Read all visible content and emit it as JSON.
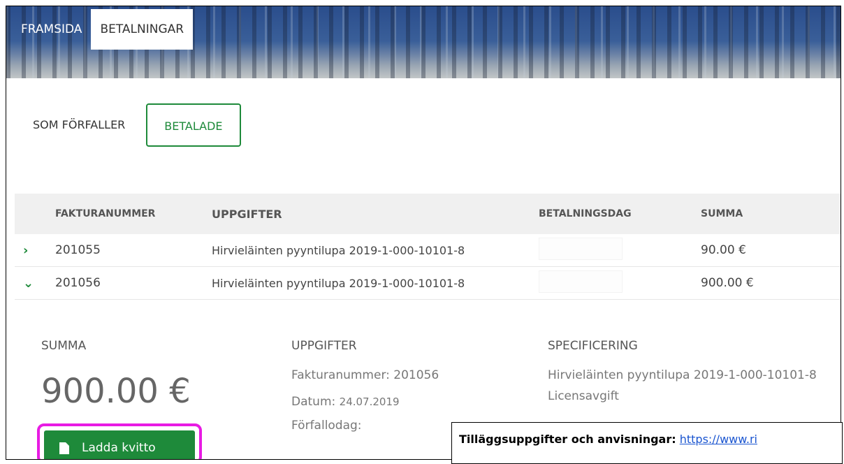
{
  "nav": {
    "tabs": [
      "FRAMSIDA",
      "BETALNINGAR"
    ],
    "active": "BETALNINGAR"
  },
  "subtabs": {
    "due_label": "SOM FÖRFALLER",
    "paid_label": "BETALADE"
  },
  "table": {
    "columns": [
      "FAKTURANUMMER",
      "UPPGIFTER",
      "BETALNINGSDAG",
      "SUMMA"
    ],
    "rows": [
      {
        "toggle": "›",
        "number": "201055",
        "info": "Hirvieläinten pyyntilupa 2019-1-000-10101-8",
        "date": "",
        "sum": "90.00 €"
      },
      {
        "toggle": "⌄",
        "number": "201056",
        "info": "Hirvieläinten pyyntilupa 2019-1-000-10101-8",
        "date": "",
        "sum": "900.00 €"
      }
    ]
  },
  "detail": {
    "summa_label": "SUMMA",
    "summa_value": "900.00 €",
    "uppgifter_label": "UPPGIFTER",
    "invoice_line": "Fakturanummer: 201056",
    "date_label": "Datum:",
    "date_value": "24.07.2019",
    "due_label": "Förfallodag:",
    "spec_label": "SPECIFICERING",
    "spec_line1": "Hirvieläinten pyyntilupa 2019-1-000-10101-8",
    "spec_line2": "Licensavgift",
    "button_label": "Ladda kvitto"
  },
  "callout": {
    "bold": "Tilläggsuppgifter och anvisningar:",
    "link": "https://www.ri"
  },
  "colors": {
    "accent": "#1e8a3a",
    "highlight": "#e81be3",
    "header_blue": "#2a4d8c"
  }
}
